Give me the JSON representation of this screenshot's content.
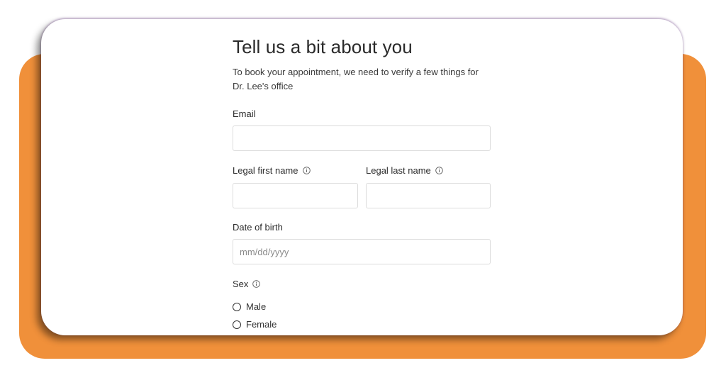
{
  "form": {
    "title": "Tell us a bit about you",
    "subtitle": "To book your appointment, we need to verify a few things for Dr. Lee's office",
    "email": {
      "label": "Email",
      "value": "",
      "placeholder": ""
    },
    "first_name": {
      "label": "Legal first name",
      "value": "",
      "placeholder": "",
      "icon": "info-icon"
    },
    "last_name": {
      "label": "Legal last name",
      "value": "",
      "placeholder": "",
      "icon": "info-icon"
    },
    "dob": {
      "label": "Date of birth",
      "value": "",
      "placeholder": "mm/dd/yyyy"
    },
    "sex": {
      "label": "Sex",
      "icon": "info-icon",
      "options": [
        {
          "label": "Male",
          "selected": false
        },
        {
          "label": "Female",
          "selected": false
        }
      ]
    }
  },
  "colors": {
    "backdrop": "#f0903a",
    "card": "#ffffff",
    "text": "#2b2b2b",
    "field_border": "#dcdcdc"
  }
}
